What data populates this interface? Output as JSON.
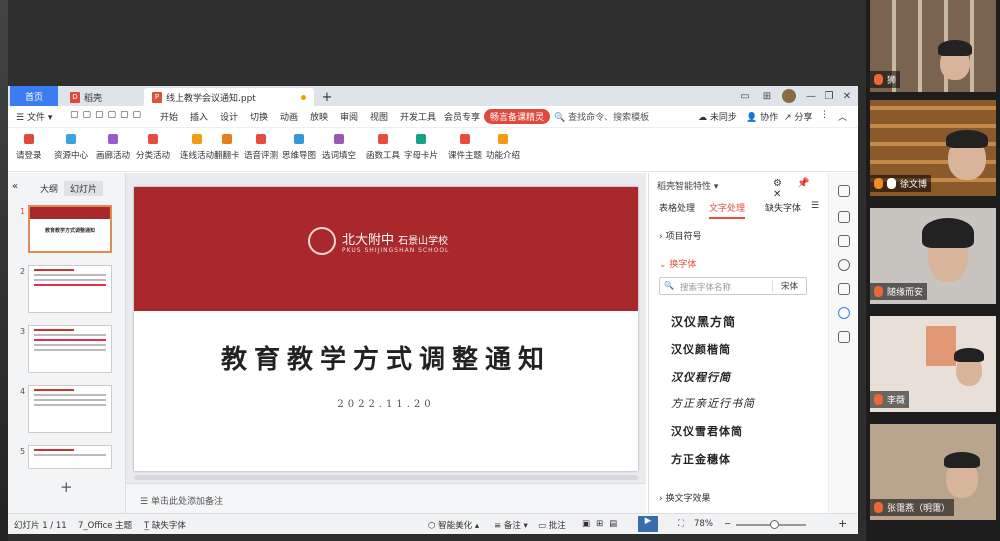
{
  "tabs": {
    "home": "首页",
    "docer": "稻壳",
    "doc": "线上教学会议通知.ppt",
    "plus": "+"
  },
  "menu": {
    "file": "文件",
    "items": [
      "开始",
      "插入",
      "设计",
      "切换",
      "动画",
      "放映",
      "审阅",
      "视图",
      "开发工具",
      "会员专享"
    ],
    "pill": "畅言备课精灵",
    "search": "查找命令、搜索模板",
    "right": [
      "未同步",
      "协作",
      "分享"
    ]
  },
  "toolbar": [
    "请登录",
    "资源中心",
    "画廊活动",
    "分类活动",
    "连线活动",
    "翻翻卡",
    "语音评测",
    "思维导图",
    "选词填空",
    "函数工具",
    "字母卡片",
    "课件主题",
    "功能介绍"
  ],
  "toolbar_colors": [
    "#e04a3c",
    "#3aa3e6",
    "#9b59d0",
    "#e74c3c",
    "#f39c12",
    "#e67e22",
    "#e74c3c",
    "#3498db",
    "#9b59b6",
    "#e74c3c",
    "#16a085",
    "#e74c3c",
    "#f39c12"
  ],
  "left": {
    "tab_outline": "大纲",
    "tab_slides": "幻灯片",
    "nums": [
      "1",
      "2",
      "3",
      "4",
      "5"
    ],
    "thumb1_title": "教育教学方式调整通知"
  },
  "slide": {
    "logo_cn": "北大附中",
    "logo_cn2": "石景山学校",
    "logo_en": "PKUS SHIJINGSHAN SCHOOL",
    "title": "教育教学方式调整通知",
    "date": "2022.11.20"
  },
  "notes": "单击此处添加备注",
  "right": {
    "header": "稻壳智能特性",
    "tabs": [
      "表格处理",
      "文字处理",
      "缺失字体"
    ],
    "sec_symbol": "项目符号",
    "sec_font": "换字体",
    "search_ph": "搜索字体名称",
    "song": "宋体",
    "fonts": [
      "汉仪黑方简",
      "汉仪颜楷简",
      "汉仪程行简",
      "方正亲近行书简",
      "汉仪雪君体简",
      "方正金穗体"
    ],
    "sec_effect": "换文字效果"
  },
  "status": {
    "slide_no": "幻灯片 1 / 11",
    "theme": "7_Office 主题",
    "missing_font": "缺失字体",
    "beautify": "智能美化",
    "notes": "备注",
    "comments": "批注",
    "zoom": "78%"
  },
  "participants": [
    {
      "name": "狮"
    },
    {
      "name": "徐文博"
    },
    {
      "name": "随缘而安"
    },
    {
      "name": "李薇"
    },
    {
      "name": "张霭燕（明霭）"
    }
  ]
}
